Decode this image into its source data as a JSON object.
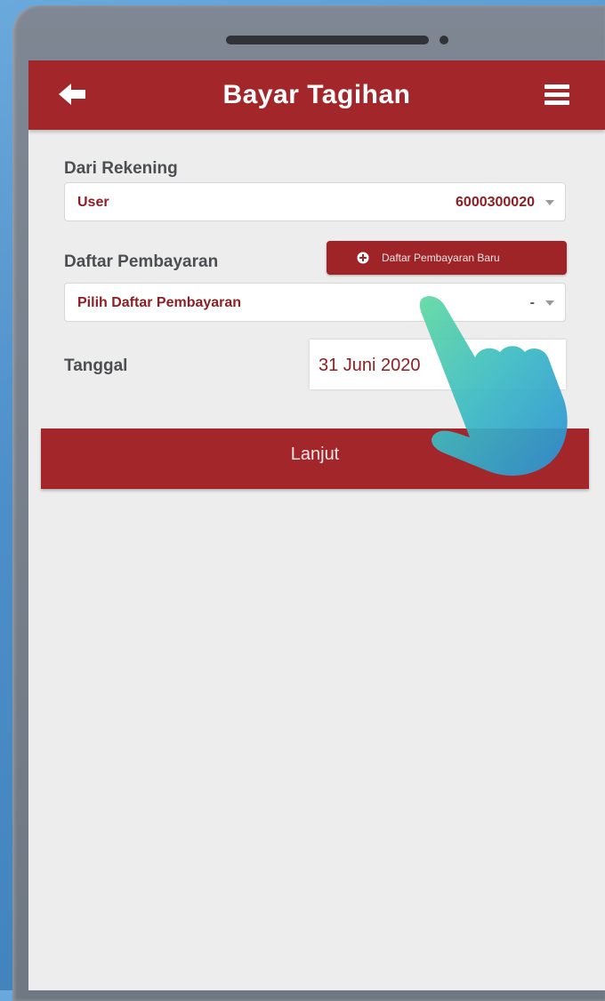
{
  "header": {
    "title": "Bayar Tagihan",
    "back_icon": "arrow-left-icon",
    "menu_icon": "hamburger-menu-icon"
  },
  "from_account": {
    "label": "Dari Rekening",
    "name": "User",
    "number": "6000300020"
  },
  "payment_list": {
    "label": "Daftar Pembayaran",
    "new_button_label": "Daftar Pembayaran Baru",
    "placeholder": "Pilih Daftar Pembayaran",
    "suffix": "-"
  },
  "date": {
    "label": "Tanggal",
    "value": "31 Juni 2020"
  },
  "next_button_label": "Lanjut",
  "colors": {
    "primary": "#a3262a",
    "accent_text": "#8d1f24",
    "background": "#ededee"
  }
}
